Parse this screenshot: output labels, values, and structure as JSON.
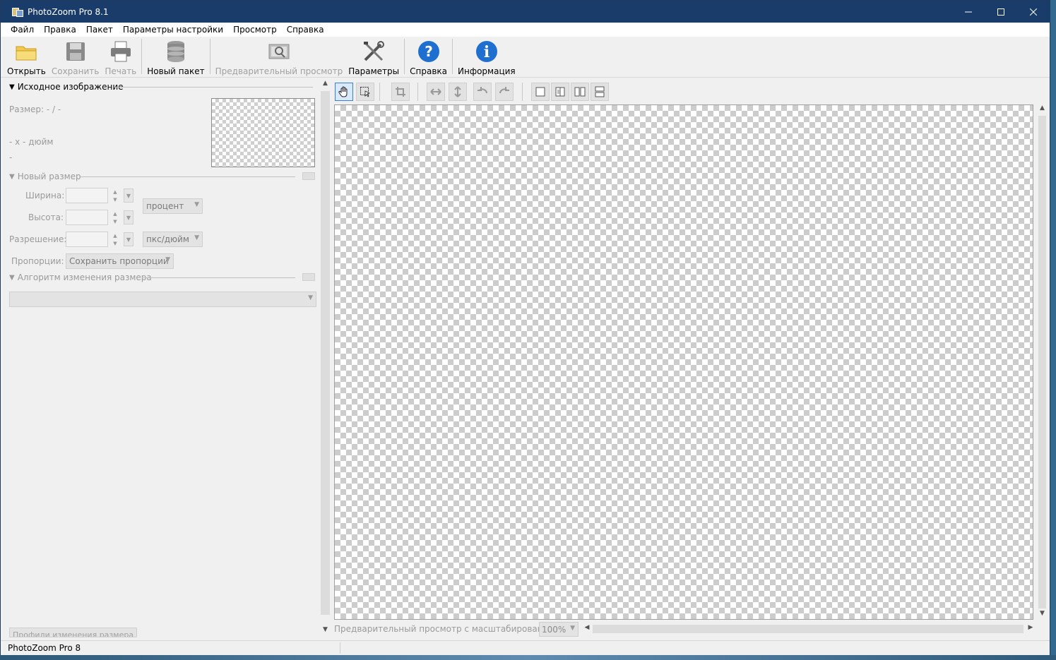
{
  "window": {
    "title": "PhotoZoom Pro 8.1"
  },
  "menu": [
    "Файл",
    "Правка",
    "Пакет",
    "Параметры настройки",
    "Просмотр",
    "Справка"
  ],
  "toolbar": {
    "open": "Открыть",
    "save": "Сохранить",
    "print": "Печать",
    "new_batch": "Новый пакет",
    "preview": "Предварительный просмотр",
    "settings": "Параметры",
    "help": "Справка",
    "info": "Информация"
  },
  "source_image": {
    "heading": "Исходное изображение",
    "size": "Размер: - / -",
    "dims": "- x - дюйм",
    "extra": "-"
  },
  "new_size": {
    "heading": "Новый размер",
    "width_label": "Ширина:",
    "height_label": "Высота:",
    "resolution_label": "Разрешение:",
    "proportions_label": "Пропорции:",
    "unit_size": "процент",
    "unit_resolution": "пкс/дюйм",
    "proportions_value": "Сохранить пропорции"
  },
  "algorithm": {
    "heading": "Алгоритм изменения размера"
  },
  "profiles_button": "Профили изменения размера",
  "preview": {
    "zoom_label": "Предварительный просмотр с масштабированием:",
    "zoom_value": "100%"
  },
  "status": {
    "text": "PhotoZoom Pro 8"
  }
}
